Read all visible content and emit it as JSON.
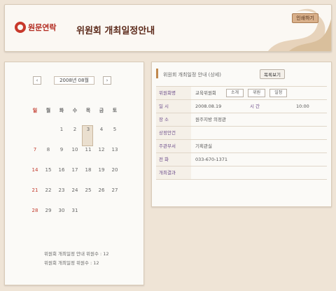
{
  "header": {
    "brand": "원문연락",
    "title": "위원회 개최일정안내",
    "print_label": "인쇄하기"
  },
  "calendar": {
    "month_label": "2008년 08월",
    "prev": "‹",
    "next": "›",
    "weekdays": [
      "일",
      "월",
      "화",
      "수",
      "목",
      "금",
      "토"
    ],
    "weeks": [
      [
        "",
        "",
        "1",
        "2",
        "3",
        "4",
        "5"
      ],
      [
        "7",
        "8",
        "9",
        "10",
        "11",
        "12",
        "13"
      ],
      [
        "14",
        "15",
        "16",
        "17",
        "18",
        "19",
        "20"
      ],
      [
        "21",
        "22",
        "23",
        "24",
        "25",
        "26",
        "27"
      ],
      [
        "28",
        "29",
        "30",
        "31",
        "",
        "",
        ""
      ]
    ],
    "legend": [
      "위원회 개최일정 안내 위원수 : 12",
      "위원회 개최일정 위원수 : 12"
    ]
  },
  "detail": {
    "title": "위원회 개최일정 안내 (상세)",
    "list_label": "목록보기",
    "rows": [
      {
        "label": "위원회명",
        "value": "교육위원회",
        "buttons": [
          "소개",
          "위원",
          "일정"
        ]
      },
      {
        "label": "일  시",
        "value": "2008.08.19",
        "sub_label": "시  간",
        "sub_value": "10:00"
      },
      {
        "label": "장  소",
        "value": "원주지방 의정관"
      },
      {
        "label": "상정안건",
        "value": ""
      },
      {
        "label": "주관부서",
        "value": "기획관실"
      },
      {
        "label": "전  화",
        "value": "033-670-1371"
      },
      {
        "label": "개최결과",
        "value": ""
      }
    ]
  },
  "colors": {
    "background": "#efe4d6",
    "accent": "#c8392b",
    "label": "#6b4b8a"
  }
}
